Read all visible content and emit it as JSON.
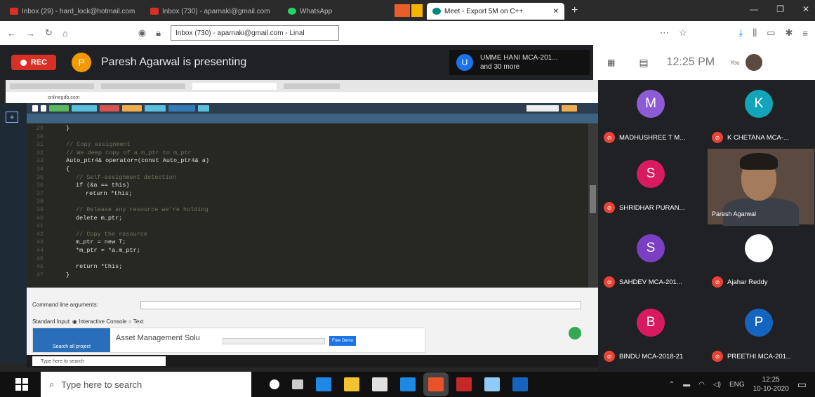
{
  "browser": {
    "tabs": [
      {
        "label": "Inbox (29) - hard_lock@hotmail.com",
        "favicon_color": "#d93025"
      },
      {
        "label": "Inbox (730) - aparnaki@gmail.com",
        "favicon_color": "#d93025"
      },
      {
        "label": "WhatsApp",
        "favicon_color": "#25d366"
      },
      {
        "label": "Meet - Export 5M on C++",
        "favicon_color": "#00897b"
      }
    ],
    "url": "Inbox (730) - aparnaki@gmail.com - Linal"
  },
  "meet": {
    "rec_label": "REC",
    "presenter_initial": "P",
    "presenting_text": "Paresh Agarwal is presenting",
    "pinned": {
      "initial": "U",
      "line1": "UMME HANI MCA-201...",
      "line2": "and 30 more"
    },
    "time": "12:25 PM",
    "you_label": "You"
  },
  "shared_screen": {
    "inner_url": "onlinegdb.com",
    "code_lines": [
      {
        "n": "29",
        "text": "}",
        "indent": 0,
        "comment": false
      },
      {
        "n": "30",
        "text": "",
        "indent": 0,
        "comment": false
      },
      {
        "n": "31",
        "text": "// Copy assignment",
        "indent": 0,
        "comment": true
      },
      {
        "n": "32",
        "text": "// We deep copy of a.m_ptr to m_ptr",
        "indent": 0,
        "comment": true
      },
      {
        "n": "33",
        "text": "Auto_ptr4& operator=(const Auto_ptr4& a)",
        "indent": 0,
        "comment": false
      },
      {
        "n": "34",
        "text": "{",
        "indent": 0,
        "comment": false
      },
      {
        "n": "35",
        "text": "// Self-assignment detection",
        "indent": 2,
        "comment": true
      },
      {
        "n": "36",
        "text": "if (&a == this)",
        "indent": 2,
        "comment": false
      },
      {
        "n": "37",
        "text": "return *this;",
        "indent": 4,
        "comment": false
      },
      {
        "n": "38",
        "text": "",
        "indent": 0,
        "comment": false
      },
      {
        "n": "39",
        "text": "// Release any resource we're holding",
        "indent": 2,
        "comment": true
      },
      {
        "n": "40",
        "text": "delete m_ptr;",
        "indent": 2,
        "comment": false
      },
      {
        "n": "41",
        "text": "",
        "indent": 0,
        "comment": false
      },
      {
        "n": "42",
        "text": "// Copy the resource",
        "indent": 2,
        "comment": true
      },
      {
        "n": "43",
        "text": "m_ptr = new T;",
        "indent": 2,
        "comment": false
      },
      {
        "n": "44",
        "text": "*m_ptr = *a.m_ptr;",
        "indent": 2,
        "comment": false
      },
      {
        "n": "45",
        "text": "",
        "indent": 0,
        "comment": false
      },
      {
        "n": "46",
        "text": "return *this;",
        "indent": 2,
        "comment": false
      },
      {
        "n": "47",
        "text": "}",
        "indent": 0,
        "comment": false
      }
    ],
    "cmd_args_label": "Command line arguments:",
    "stdin_label": "Standard Input: ◉ Interactive Console  ○ Text",
    "ad": {
      "image_label": "Search all project",
      "title": "Asset Management Solu",
      "button": "Free Demo"
    },
    "inner_search": "Type here to search"
  },
  "participants": [
    {
      "initial": "M",
      "name": "MADHUSHREE T M...",
      "color": "#8e5bd6"
    },
    {
      "initial": "K",
      "name": "K CHETANA MCA-...",
      "color": "#12a4b8"
    },
    {
      "initial": "S",
      "name": "SHRIDHAR PURAN...",
      "color": "#d81b60"
    },
    {
      "initial": "S",
      "name": "SAHDEV MCA-201...",
      "color": "#7b3fc4"
    },
    {
      "initial": "",
      "name": "Ajahar Reddy",
      "color": "#ffffff"
    },
    {
      "initial": "B",
      "name": "BINDU MCA-2018-21",
      "color": "#d81b60"
    },
    {
      "initial": "P",
      "name": "PREETHI MCA-201...",
      "color": "#1565c0"
    }
  ],
  "video_participant": "Paresh Agarwal",
  "taskbar": {
    "search_placeholder": "Type here to search",
    "lang": "ENG",
    "time": "12:25",
    "date": "10-10-2020"
  }
}
